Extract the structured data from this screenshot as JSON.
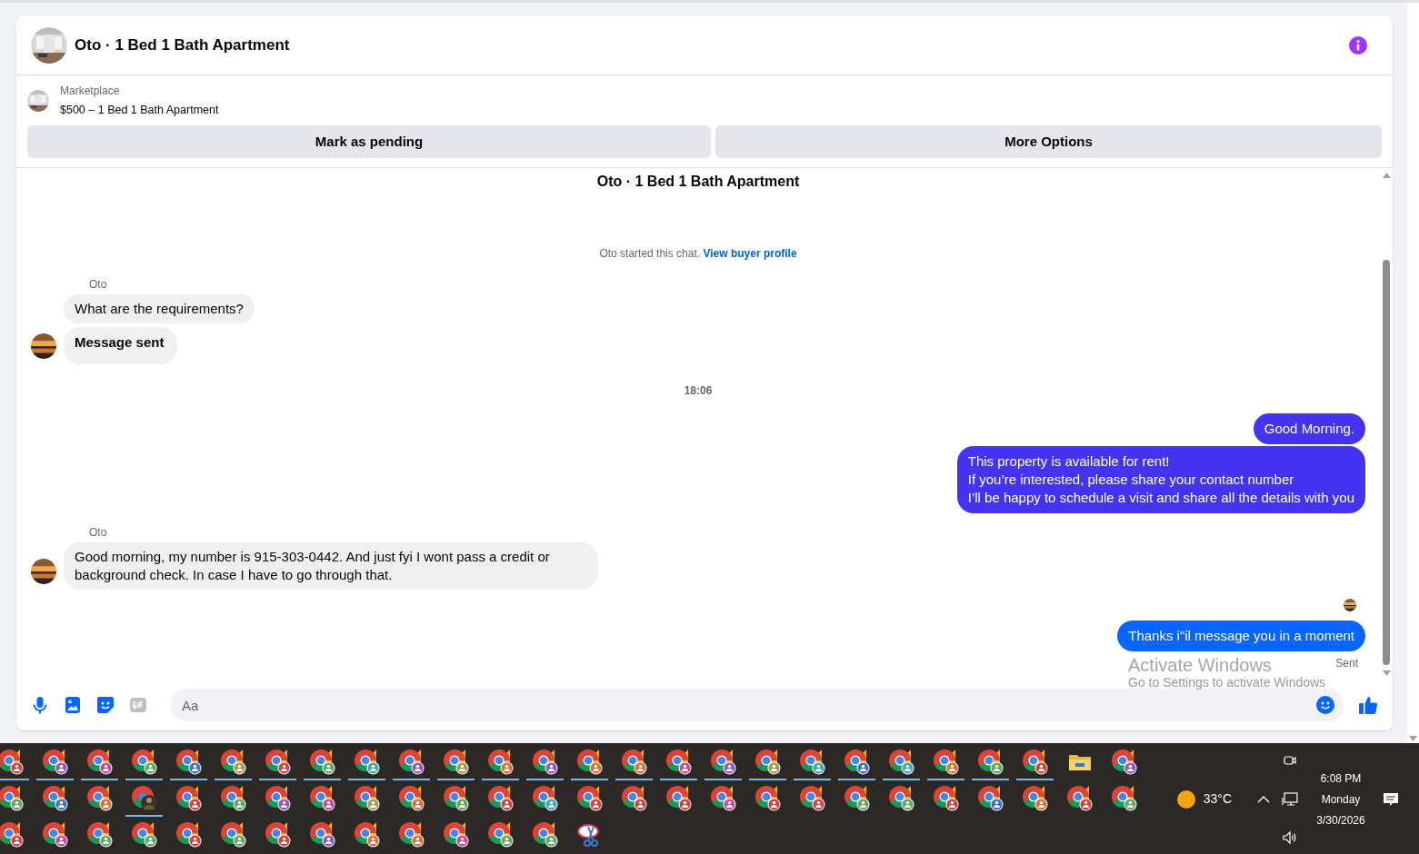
{
  "chat_header": {
    "title": "Oto · 1 Bed 1 Bath Apartment"
  },
  "listing": {
    "source": "Marketplace",
    "title": "$500 – 1 Bed 1 Bath Apartment"
  },
  "actions": [
    "Mark as pending",
    "More Options"
  ],
  "thread": [
    {
      "kind": "title",
      "text": "Oto · 1 Bed 1 Bath Apartment"
    },
    {
      "kind": "system",
      "text": "Oto started this chat.",
      "link": "View buyer profile"
    },
    {
      "kind": "incoming",
      "sender": "Oto",
      "messages": [
        {
          "text": "What are the requirements?",
          "bold": false
        },
        {
          "text": "Message sent",
          "bold": true
        }
      ]
    },
    {
      "kind": "timestamp",
      "text": "18:06"
    },
    {
      "kind": "outgoing",
      "color": "#4433f0",
      "messages": [
        {
          "text": "Good Morning."
        },
        {
          "text": "This property is available for rent!\nIf you’re interested, please share your contact number\nI’ll be happy to schedule a visit and share all the details with you"
        }
      ]
    },
    {
      "kind": "incoming",
      "sender": "Oto",
      "messages": [
        {
          "text": "Good morning, my number is 915-303-0442. And just fyi I wont pass a credit or background check. In case I have to go through that.",
          "bold": false
        }
      ]
    },
    {
      "kind": "seen"
    },
    {
      "kind": "outgoing",
      "color": "#0866ff",
      "messages": [
        {
          "text": "Thanks i\"il message you in a moment"
        }
      ],
      "status": "Sent"
    }
  ],
  "composer": {
    "placeholder": "Aa"
  },
  "os_notice": {
    "title": "Activate Windows",
    "text": "Go to Settings to activate Windows"
  },
  "taskbar": {
    "rows": [
      [
        {
          "kind": "chrome",
          "running": true,
          "color": "#e53935"
        },
        {
          "kind": "chrome",
          "running": true,
          "color": "#9c4dcc"
        },
        {
          "kind": "chrome",
          "running": true,
          "color": "#d6409f"
        },
        {
          "kind": "chrome",
          "running": true,
          "color": "#5fa85f"
        },
        {
          "kind": "chrome",
          "running": true,
          "color": "#3b6fd8"
        },
        {
          "kind": "chrome",
          "running": true,
          "color": "#a89a4a"
        },
        {
          "kind": "chrome",
          "running": true,
          "color": "#e53935"
        },
        {
          "kind": "chrome",
          "running": true,
          "color": "#5fa85f"
        },
        {
          "kind": "chrome",
          "running": true,
          "color": "#3fa7b5"
        },
        {
          "kind": "chrome",
          "running": true,
          "color": "#9c4dcc"
        },
        {
          "kind": "chrome",
          "running": true,
          "color": "#a89a4a"
        },
        {
          "kind": "chrome",
          "running": true,
          "color": "#e8692e"
        },
        {
          "kind": "chrome",
          "running": true,
          "color": "#9c4dcc"
        },
        {
          "kind": "chrome",
          "running": true,
          "color": "#e8692e"
        },
        {
          "kind": "chrome",
          "running": true,
          "color": "#e8692e"
        },
        {
          "kind": "chrome",
          "running": true,
          "color": "#d6409f"
        },
        {
          "kind": "chrome",
          "running": true,
          "color": "#9c4dcc"
        },
        {
          "kind": "chrome",
          "running": true,
          "color": "#a89a4a"
        },
        {
          "kind": "chrome",
          "running": true,
          "color": "#3fa7b5"
        },
        {
          "kind": "chrome",
          "running": true,
          "color": "#3b6fd8"
        },
        {
          "kind": "chrome",
          "running": true,
          "color": "#3fa7b5"
        },
        {
          "kind": "chrome",
          "running": true,
          "color": "#e8692e"
        },
        {
          "kind": "chrome",
          "running": true,
          "color": "#5fa85f"
        },
        {
          "kind": "chrome",
          "running": true,
          "color": "#e53935"
        },
        {
          "kind": "folder",
          "running": false
        },
        {
          "kind": "chrome",
          "running": false,
          "color": "#9c4dcc"
        }
      ],
      [
        {
          "kind": "chrome",
          "running": false,
          "color": "#5fa85f"
        },
        {
          "kind": "chrome",
          "running": false,
          "color": "#3b6fd8"
        },
        {
          "kind": "chrome",
          "running": false,
          "color": "#e8692e"
        },
        {
          "kind": "profile",
          "running": true
        },
        {
          "kind": "chrome",
          "running": false,
          "color": "#e53935"
        },
        {
          "kind": "chrome",
          "running": false,
          "color": "#5fa85f"
        },
        {
          "kind": "chrome",
          "running": false,
          "color": "#9c4dcc"
        },
        {
          "kind": "chrome",
          "running": false,
          "color": "#d6409f"
        },
        {
          "kind": "chrome",
          "running": false,
          "color": "#a89a4a"
        },
        {
          "kind": "chrome",
          "running": false,
          "color": "#e8692e"
        },
        {
          "kind": "chrome",
          "running": false,
          "color": "#5fa85f"
        },
        {
          "kind": "chrome",
          "running": false,
          "color": "#e53935"
        },
        {
          "kind": "chrome",
          "running": false,
          "color": "#3fa7b5"
        },
        {
          "kind": "chrome",
          "running": false,
          "color": "#e53935"
        },
        {
          "kind": "chrome",
          "running": false,
          "color": "#e53935"
        },
        {
          "kind": "chrome",
          "running": false,
          "color": "#e53935"
        },
        {
          "kind": "chrome",
          "running": false,
          "color": "#d6409f"
        },
        {
          "kind": "chrome",
          "running": false,
          "color": "#e53935"
        },
        {
          "kind": "chrome",
          "running": false,
          "color": "#e53935"
        },
        {
          "kind": "chrome",
          "running": false,
          "color": "#5fa85f"
        },
        {
          "kind": "chrome",
          "running": false,
          "color": "#5fa85f"
        },
        {
          "kind": "chrome",
          "running": false,
          "color": "#e53935"
        },
        {
          "kind": "chrome",
          "running": false,
          "color": "#3b6fd8"
        },
        {
          "kind": "chrome",
          "running": false,
          "color": "#e8692e"
        },
        {
          "kind": "chrome",
          "running": false,
          "color": "#e53935"
        },
        {
          "kind": "chrome",
          "running": false,
          "color": "#5fa85f"
        }
      ],
      [
        {
          "kind": "chrome",
          "running": false,
          "color": "#e53935"
        },
        {
          "kind": "chrome",
          "running": false,
          "color": "#d6409f"
        },
        {
          "kind": "chrome",
          "running": false,
          "color": "#5fa85f"
        },
        {
          "kind": "chrome",
          "running": false,
          "color": "#5fa85f"
        },
        {
          "kind": "chrome",
          "running": false,
          "color": "#e53935"
        },
        {
          "kind": "chrome",
          "running": false,
          "color": "#5fa85f"
        },
        {
          "kind": "chrome",
          "running": false,
          "color": "#e53935"
        },
        {
          "kind": "chrome",
          "running": false,
          "color": "#9c4dcc"
        },
        {
          "kind": "chrome",
          "running": false,
          "color": "#e8692e"
        },
        {
          "kind": "chrome",
          "running": false,
          "color": "#e8692e"
        },
        {
          "kind": "chrome",
          "running": false,
          "color": "#d6409f"
        },
        {
          "kind": "chrome",
          "running": false,
          "color": "#5fa85f"
        },
        {
          "kind": "chrome",
          "running": false,
          "color": "#5fa85f"
        },
        {
          "kind": "snip",
          "running": false
        }
      ]
    ],
    "weather": "33°C",
    "time": "6:08 PM",
    "day": "Monday",
    "date": "3/30/2026"
  }
}
